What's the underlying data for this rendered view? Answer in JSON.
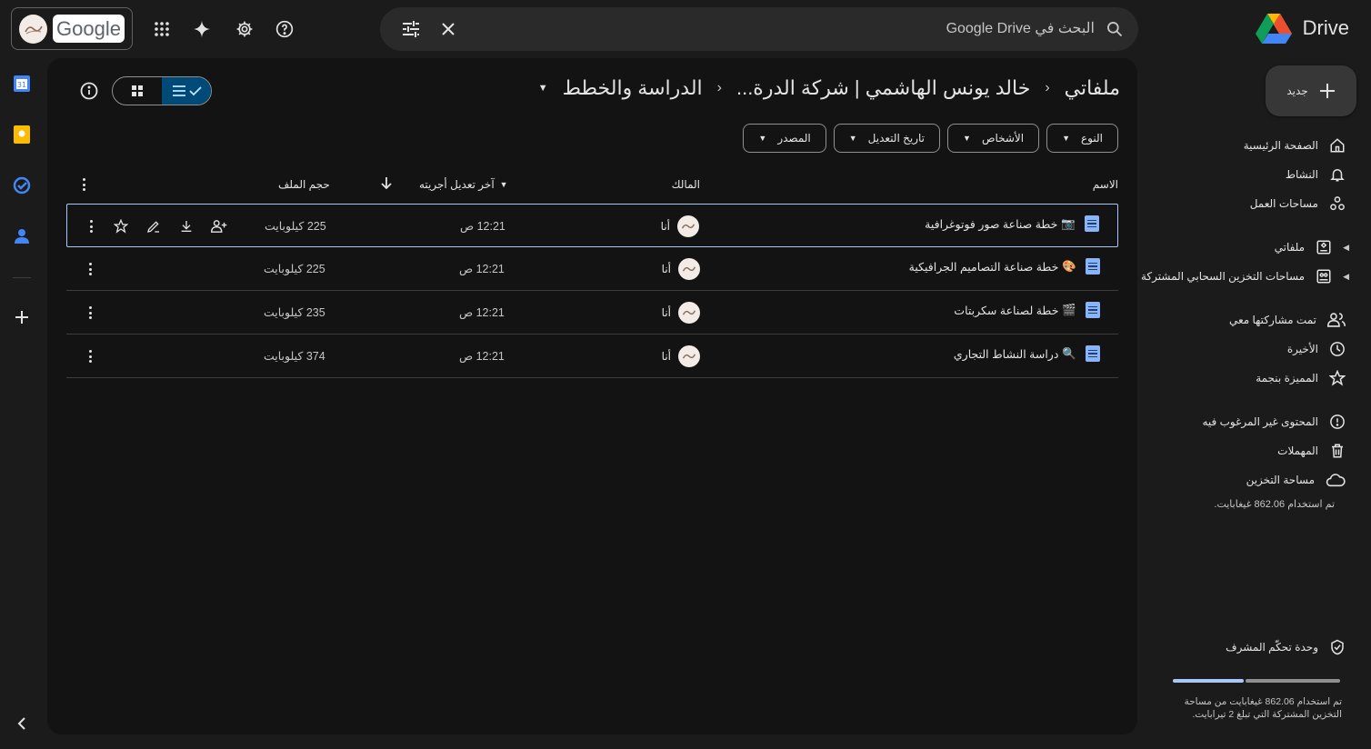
{
  "search": {
    "placeholder": "البحث في Google Drive"
  },
  "brand": {
    "google": "Google",
    "drive": "Drive"
  },
  "new_button": {
    "label": "جديد"
  },
  "sidebar": {
    "items": [
      {
        "label": "الصفحة الرئيسية",
        "icon": "home-icon"
      },
      {
        "label": "النشاط",
        "icon": "bell-icon"
      },
      {
        "label": "مساحات العمل",
        "icon": "workspaces-icon"
      },
      {
        "label": "ملفاتي",
        "icon": "my-drive-icon"
      },
      {
        "label": "مساحات التخزين السحابي المشتركة",
        "icon": "shared-drives-icon"
      },
      {
        "label": "تمت مشاركتها معي",
        "icon": "shared-people-icon"
      },
      {
        "label": "الأخيرة",
        "icon": "clock-icon"
      },
      {
        "label": "المميزة بنجمة",
        "icon": "star-icon"
      },
      {
        "label": "المحتوى غير المرغوب فيه",
        "icon": "spam-icon"
      },
      {
        "label": "المهملات",
        "icon": "trash-icon"
      },
      {
        "label": "مساحة التخزين",
        "icon": "cloud-icon"
      }
    ],
    "storage_used": "تم استخدام 862.06 غيغابايت.",
    "admin_console": "وحدة تحكّم المشرف",
    "quota_line1": "تم استخدام 862.06 غيغابايت من مساحة",
    "quota_line2": "التخزين المشتركة التي تبلغ 2 تيرابايت."
  },
  "breadcrumb": {
    "items": [
      "ملفاتي",
      "خالد يونس الهاشمي | شركة الدرة...",
      "الدراسة والخطط"
    ]
  },
  "filters": [
    "النوع",
    "الأشخاص",
    "تاريخ التعديل",
    "المصدر"
  ],
  "table": {
    "headers": {
      "name": "الاسم",
      "owner": "المالك",
      "modified": "آخر تعديل أجريته",
      "size": "حجم الملف"
    },
    "rows": [
      {
        "emoji": "📷",
        "name": "خطة صناعة صور فوتوغرافية",
        "owner": "أنا",
        "modified": "12:21 ص",
        "size": "225 كيلوبايت"
      },
      {
        "emoji": "🎨",
        "name": "خطة صناعة التصاميم الجرافيكية",
        "owner": "أنا",
        "modified": "12:21 ص",
        "size": "225 كيلوبايت"
      },
      {
        "emoji": "🎬",
        "name": "خطة لصناعة سكربتات",
        "owner": "أنا",
        "modified": "12:21 ص",
        "size": "235 كيلوبايت"
      },
      {
        "emoji": "🔍",
        "name": "دراسة النشاط التجاري",
        "owner": "أنا",
        "modified": "12:21 ص",
        "size": "374 كيلوبايت"
      }
    ]
  },
  "colors": {
    "accent": "#a8c7fa",
    "toggle_active": "#004a77",
    "background": "#1b1b1b",
    "panel": "#131314"
  }
}
